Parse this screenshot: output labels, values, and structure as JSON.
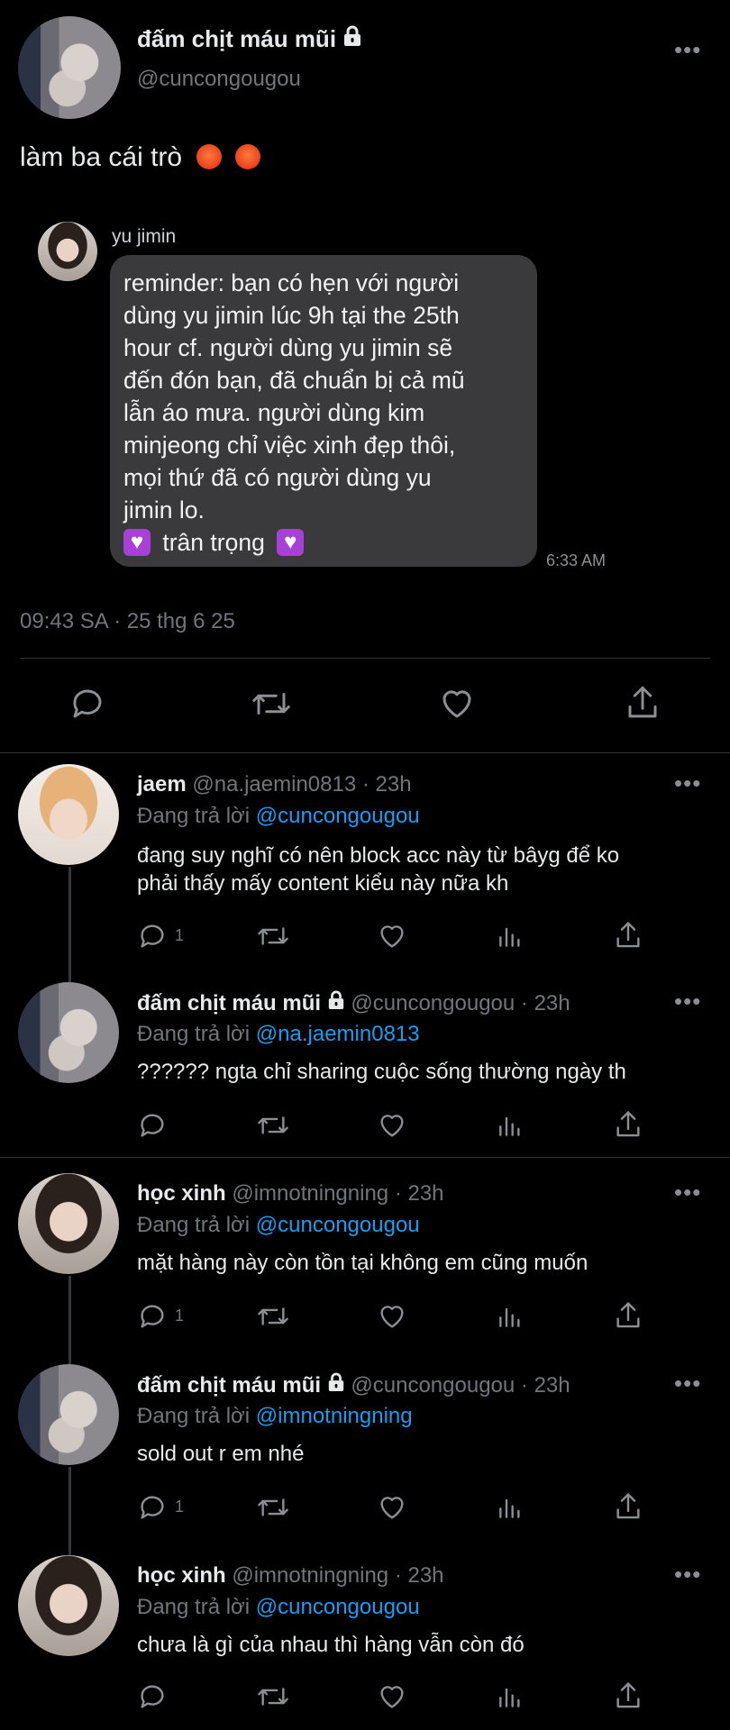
{
  "main_tweet": {
    "display_name": "đấm chịt máu mũi",
    "handle": "@cuncongougou",
    "text": "làm ba cái trò",
    "emoji": [
      "angry-face",
      "angry-face"
    ],
    "timestamp": "09:43 SA · 25 thg 6 25"
  },
  "embedded_message": {
    "sender": "yu jimin",
    "body_lines": [
      "reminder: bạn có hẹn với người",
      "dùng yu jimin lúc 9h tại the 25th",
      "hour cf. người dùng yu jimin sẽ",
      "đến đón bạn, đã chuẩn bị cả mũ",
      "lẫn áo mưa. người dùng kim",
      "minjeong chỉ việc xinh đẹp thôi,",
      "mọi thứ đã có người dùng yu",
      "jimin lo."
    ],
    "signoff": "trân trọng",
    "time": "6:33 AM"
  },
  "replies": [
    {
      "display_name": "jaem",
      "handle": "@na.jaemin0813",
      "age": "· 23h",
      "reply_prefix": "Đang trả lời",
      "reply_to": "@cuncongougou",
      "text_lines": [
        "đang suy nghĩ có nên block acc này từ bâyg để ko",
        "phải thấy mấy content kiểu này nữa kh"
      ],
      "reply_count": "1",
      "locked": false
    },
    {
      "display_name": "đấm chịt máu mũi",
      "handle": "@cuncongougou",
      "age": "· 23h",
      "reply_prefix": "Đang trả lời",
      "reply_to": "@na.jaemin0813",
      "text_lines": [
        "?????? ngta chỉ sharing cuộc sống thường ngày th"
      ],
      "reply_count": "",
      "locked": true
    },
    {
      "display_name": "học xinh",
      "handle": "@imnotningning",
      "age": "· 23h",
      "reply_prefix": "Đang trả lời",
      "reply_to": "@cuncongougou",
      "text_lines": [
        "mặt hàng này còn tồn tại không em cũng muốn"
      ],
      "reply_count": "1",
      "locked": false
    },
    {
      "display_name": "đấm chịt máu mũi",
      "handle": "@cuncongougou",
      "age": "· 23h",
      "reply_prefix": "Đang trả lời",
      "reply_to": "@imnotningning",
      "text_lines": [
        "sold out r em nhé"
      ],
      "reply_count": "1",
      "locked": true
    },
    {
      "display_name": "học xinh",
      "handle": "@imnotningning",
      "age": "· 23h",
      "reply_prefix": "Đang trả lời",
      "reply_to": "@cuncongougou",
      "text_lines": [
        "chưa là gì của nhau thì hàng vẫn còn đó"
      ],
      "reply_count": "",
      "locked": false
    }
  ],
  "more_label": "•••",
  "colors": {
    "background": "#000000",
    "text": "#e7e9ea",
    "muted": "#71767b",
    "link": "#1d9bf0",
    "bubble": "#3a3a3c"
  }
}
